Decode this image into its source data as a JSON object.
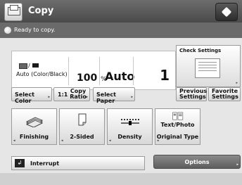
{
  "header": {
    "title": "Copy"
  },
  "status": {
    "message": "Ready to copy."
  },
  "main": {
    "color_mode": "Auto (Color/Black)",
    "color_icon_separator": "/",
    "ratio_value": "100",
    "ratio_unit": "%",
    "paper": "Auto",
    "copies": "1"
  },
  "check_settings": {
    "label": "Check Settings"
  },
  "buttons": {
    "select_color": "Select Color",
    "ratio_number": "1:1",
    "copy_ratio": "Copy Ratio",
    "select_paper": "Select Paper",
    "previous_settings": "Previous Settings",
    "favorite_settings": "Favorite Settings"
  },
  "functions": [
    {
      "label": "Finishing"
    },
    {
      "label": "2-Sided"
    },
    {
      "label": "Density"
    },
    {
      "label": "Original Type",
      "sub": "Text/Photo"
    }
  ],
  "interrupt": {
    "label": "Interrupt"
  },
  "options": {
    "label": "Options"
  },
  "icons": {
    "app": "copy-icon",
    "home": "home-icon",
    "status": "status-indicator-icon",
    "arrow": "corner-arrow-icon"
  }
}
